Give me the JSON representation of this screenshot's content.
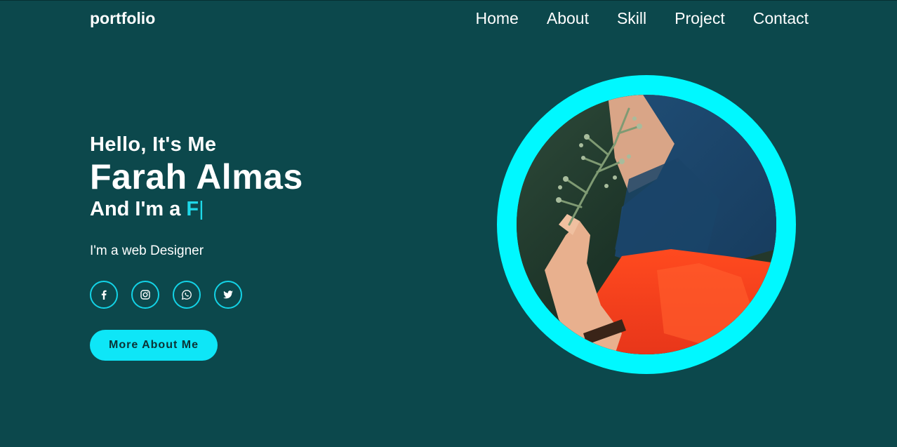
{
  "header": {
    "logo": "portfolio",
    "nav": [
      "Home",
      "About",
      "Skill",
      "Project",
      "Contact"
    ]
  },
  "hero": {
    "greeting": "Hello, It's Me",
    "name": "Farah Almas",
    "role_prefix": "And I'm a ",
    "role_typed": "F",
    "cursor": "|",
    "description": "I'm a web Designer",
    "cta_label": "More About Me"
  },
  "socials": [
    {
      "icon": "facebook-icon"
    },
    {
      "icon": "instagram-icon"
    },
    {
      "icon": "whatsapp-icon"
    },
    {
      "icon": "twitter-icon"
    }
  ],
  "colors": {
    "background": "#0c484c",
    "accent": "#0ee6f7",
    "ring": "#00f8ff"
  }
}
